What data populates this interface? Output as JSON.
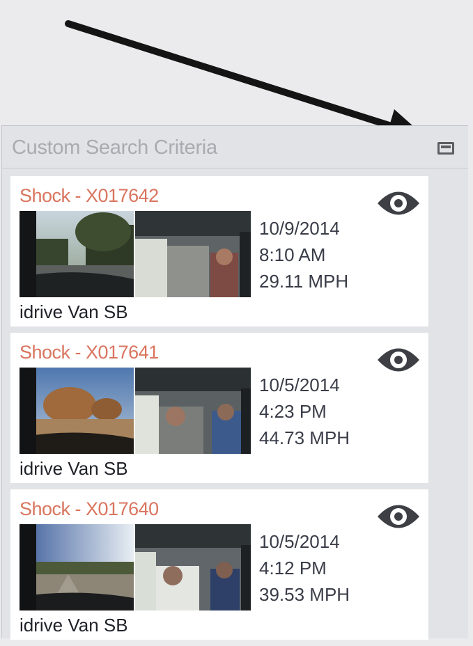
{
  "panel": {
    "title": "Custom Search Criteria",
    "minimize_icon": "minimize-icon"
  },
  "events": [
    {
      "title": "Shock - X017642",
      "date": "10/9/2014",
      "time": "8:10 AM",
      "speed": "29.11 MPH",
      "vehicle": "idrive Van SB"
    },
    {
      "title": "Shock - X017641",
      "date": "10/5/2014",
      "time": "4:23 PM",
      "speed": "44.73 MPH",
      "vehicle": "idrive Van SB"
    },
    {
      "title": "Shock - X017640",
      "date": "10/5/2014",
      "time": "4:12 PM",
      "speed": "39.53 MPH",
      "vehicle": "idrive Van SB"
    }
  ],
  "colors": {
    "event_title": "#d9755f",
    "arrow": "#141414",
    "icon": "#3d3f45"
  },
  "icons": {
    "view": "eye-icon",
    "annotation": "arrow-pointer"
  }
}
